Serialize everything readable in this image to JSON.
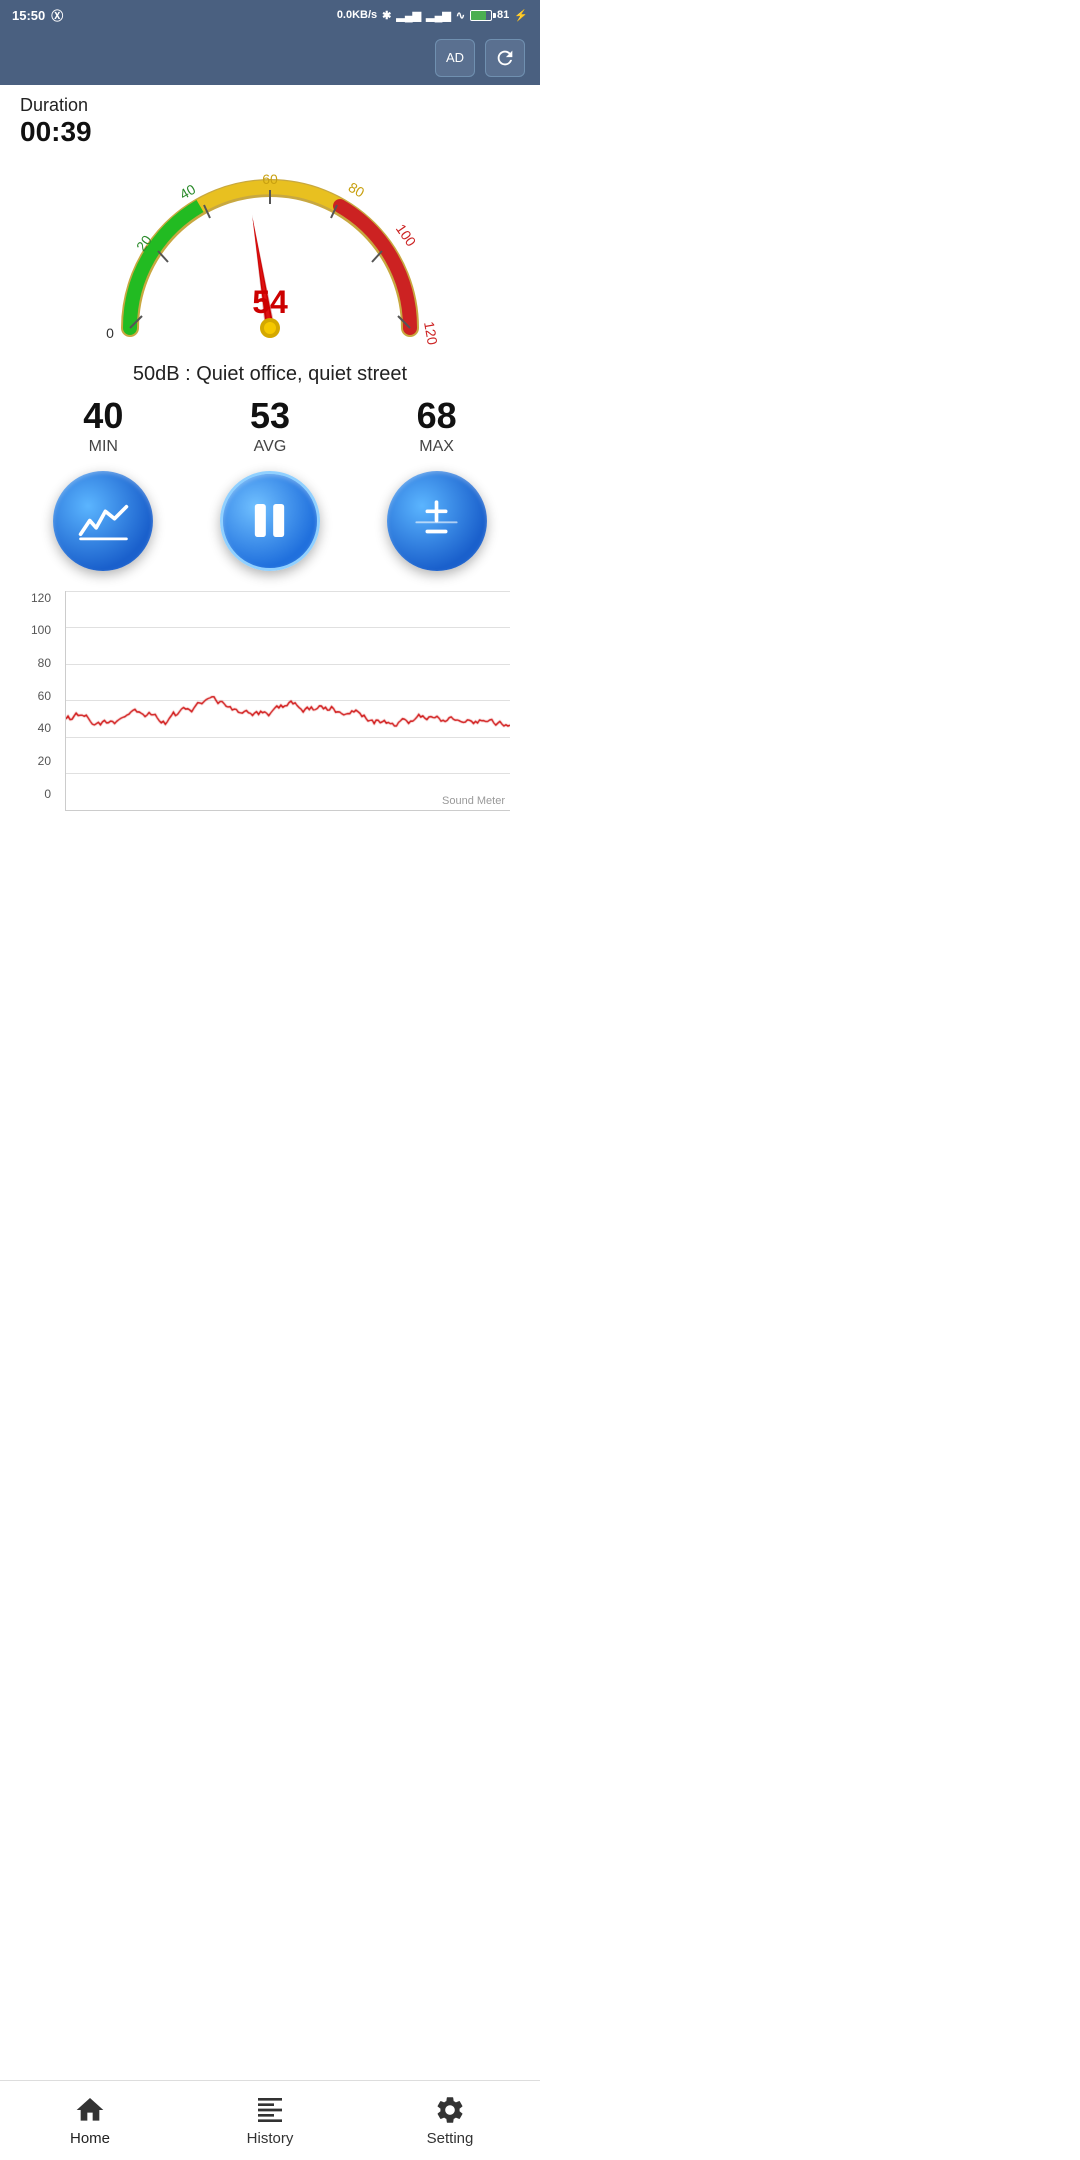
{
  "statusBar": {
    "time": "15:50",
    "network": "0.0KB/s",
    "batteryPercent": "81"
  },
  "topBar": {
    "adLabel": "AD",
    "refreshTitle": "refresh"
  },
  "duration": {
    "label": "Duration",
    "value": "00:39"
  },
  "gauge": {
    "currentValue": "54",
    "minScale": "0",
    "maxScale": "120",
    "needleAngle": 0
  },
  "description": "50dB : Quiet office, quiet street",
  "stats": {
    "min": {
      "value": "40",
      "label": "MIN"
    },
    "avg": {
      "value": "53",
      "label": "AVG"
    },
    "max": {
      "value": "68",
      "label": "MAX"
    }
  },
  "actions": {
    "chart": "chart-button",
    "pause": "pause-button",
    "plusminus": "plusminus-button"
  },
  "chart": {
    "yLabels": [
      "120",
      "100",
      "80",
      "60",
      "40",
      "20",
      "0"
    ],
    "brandLabel": "Sound Meter"
  },
  "bottomNav": {
    "items": [
      {
        "id": "home",
        "label": "Home",
        "active": true
      },
      {
        "id": "history",
        "label": "History",
        "active": false
      },
      {
        "id": "setting",
        "label": "Setting",
        "active": false
      }
    ]
  }
}
